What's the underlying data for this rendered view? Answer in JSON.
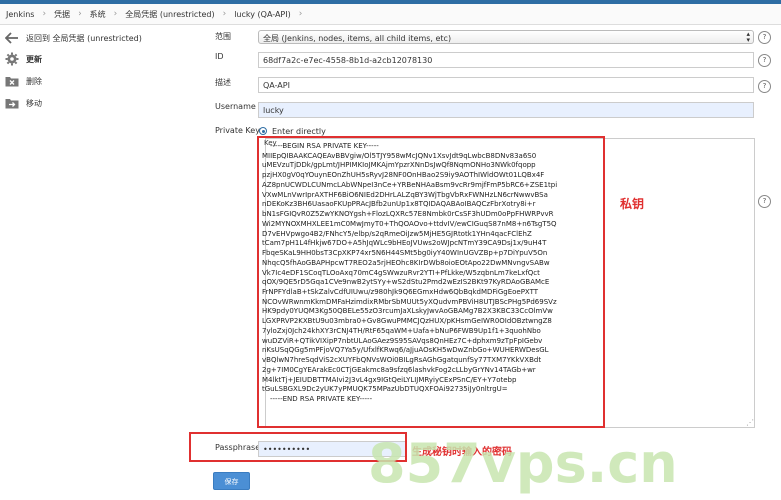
{
  "breadcrumb": [
    "Jenkins",
    "凭据",
    "系统",
    "全局凭据 (unrestricted)",
    "lucky (QA-API)"
  ],
  "sidebar": {
    "items": [
      {
        "label": "返回到 全局凭据 (unrestricted)",
        "icon": "arrow-left-icon"
      },
      {
        "label": "更新",
        "icon": "gear-icon"
      },
      {
        "label": "删除",
        "icon": "folder-delete-icon"
      },
      {
        "label": "移动",
        "icon": "folder-move-icon"
      }
    ]
  },
  "form": {
    "scope_label": "范围",
    "scope_value": "全局 (Jenkins, nodes, items, all child items, etc)",
    "id_label": "ID",
    "id_value": "68df7a2c-e7ec-4558-8b1d-a2cb12078130",
    "desc_label": "描述",
    "desc_value": "QA-API",
    "username_label": "Username",
    "username_value": "lucky",
    "private_key_label": "Private Key",
    "enter_directly_label": "Enter directly",
    "key_label": "Key",
    "key_lines": [
      "-----BEGIN RSA PRIVATE KEY-----",
      "MIIEpQIBAAKCAQEAvBBVgiw/Ol5TJY958wMcJQNv1XsvJdt9qLwbcB8DNv83a6S0",
      "uMEVzuTjDDk/gpLmt/JHPIMKIoJMKAjmYpzrXNnDsJwQf8NqmONHo3NWk0fqopp",
      "pzjHX0gV0qYOuynEOnZhUH5sRyvJ28NF0OnHBao2S9iy9AOThIWldOWt01LQBx4F",
      "AZ8pnUCWDLCUNmcLAbWNpeI3nCe+YRBeNHAaBsm9vcRr9mjfFmP5bRC6+ZSE1tpi",
      "VXwMLnVwrIprAXTHF6BiO6NIEd2DHrLALZqBY3WjTbgVbRxFWNHzLN6crNwwvBSa",
      "nDEKoKz3BH6UasaoFKUpPRAcJBfb2unUp1x8TQIDAQABAoIBAQCzFbrXotry8i+r",
      "bN1sFGIQvR0Z5ZwYKNOYgsh+FlozLQXRc57E8Nmbk0rCsSF3hUDm0oPpFHWRPvvR",
      "Wi2MYNOXMHXLEE1mC0MwJmyT0+ThQOAOvo+ttdvIV/ewCIGuqS87nM8+n6TsgT5Q",
      "D7vEHVpwgo4B2/FNhcY5/elbp/s2qRmeOiJzw5MjHE5GJRtotk1YHn4qacFClEhZ",
      "tCam7pH1L4fHkjw67DO+A5hJqWLc9bHEoJVUws2oWJpcNTmY39CA9Dsj1x/9uH4T",
      "FbqeSKaL9HH0bsT3CpXKP74xr5N6H44SMt5bg0iyY40WInUGVZBp+p7DiYpuV5On",
      "NhqcQ5fhAoGBAPHpcwT7REO2a5rjHEOhc8KIrDWb8oioEOtApo22DwMNvngvSABw",
      "Vk7Ic4eDF1SCoqTLOoAxq70mC4gSWwzuRvr2YTI+PfLkke/W5zqbnLm7keLxfQct",
      "qOX/9QE5rD5Gqa1CVe9nwB2ytSYy+wS2dStu2Pmd2wEzIS2BKt97KyRDAoGBAMcE",
      "FrNPFYdlaB+tSkZalvCdfUIUwu/z980hJk9Q6EGmxHdw6QbBqkdMDFiGgEoePXTT",
      "NCOvWRwnmKkmDMFaHzimdixRMbrSbMUUt5yXQudvmPBViH8UTJBScPHg5Pd69SVz",
      "HK9pdy0YUQM3Kg50QBELe55zO3rcumJaXLskyJwvAoGBAMg7B2X3KBC33CcOlmVw",
      "LGXPRVP2KXBtU9u03mbra0+Gv8GwuPMMCJQzHUX/pKHsmGeIWR0OIdOBztwngZ8",
      "7yloZxj0Jch24khXY3rCNJ4TH/RtF65qaWM+Uafa+bNuP6FWB9Up1f1+3quohNbo",
      "wuDZViR+QTikVIXipP7nbtULAoGAez9S95SAVqs8QnHEz7C+dphxm9zTpFpIGebv",
      "nKsUSqQGg5mPFjoVQ7Ya5y/UfxlfKRwq6/aJjuAOsKH5wDwZnbGo+WUHERWDesGL",
      "vBQlwN7hreSqdViS2cXUYFbQNVsWOi0BILgRsAGhGgatqunfSy77TXM7YKkVXBdt",
      "2g+7IM0CgYEArakEc0CTjGEakmc8a9sfzq6lashvkFog2cLLbyGrYNv14TAGb+wr",
      "M4lktTj+JEIUDBTTMAIvi2J3vL4gx9IGtQeiLYLIJMRyiyCExPSnC/EY+Y7otebp",
      "tGuLSBGXL9Dc2yUK7yPMUQK75MPazUbDTUQXFOAi92735iJy0nltrgU=",
      "-----END RSA PRIVATE KEY-----"
    ],
    "passphrase_label": "Passphrase",
    "passphrase_value": "••••••••••",
    "save_label": "保存"
  },
  "annotations": {
    "private_key_note": "私钥",
    "passphrase_note": "生成秘钥时输入的密码"
  },
  "watermark": "857vps.cn",
  "colors": {
    "accent": "#2e6da4",
    "annotation_red": "#e03030",
    "save_button": "#4b8fd5"
  }
}
